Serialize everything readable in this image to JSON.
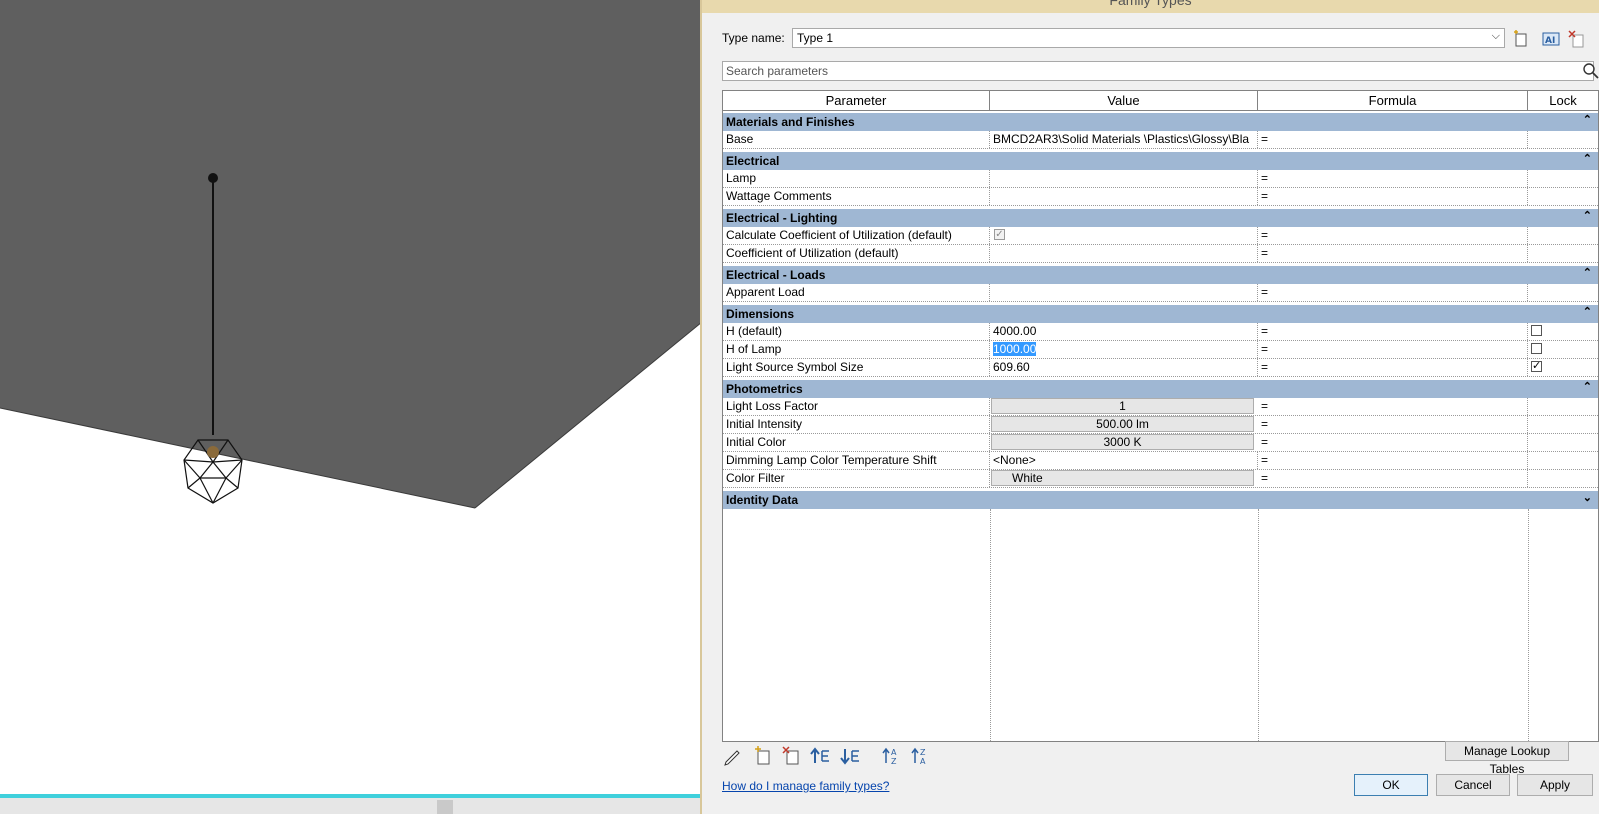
{
  "dialog": {
    "title": "Family Types",
    "type_name_label": "Type name:",
    "type_name_value": "Type 1",
    "search_placeholder": "Search parameters"
  },
  "columns": {
    "parameter": "Parameter",
    "value": "Value",
    "formula": "Formula",
    "lock": "Lock"
  },
  "groups": [
    {
      "label": "Materials and Finishes",
      "state": "expanded"
    },
    {
      "label": "Electrical",
      "state": "expanded"
    },
    {
      "label": "Electrical - Lighting",
      "state": "expanded"
    },
    {
      "label": "Electrical - Loads",
      "state": "expanded"
    },
    {
      "label": "Dimensions",
      "state": "expanded"
    },
    {
      "label": "Photometrics",
      "state": "expanded"
    },
    {
      "label": "Identity Data",
      "state": "collapsed"
    }
  ],
  "rows": {
    "base": {
      "param": "Base",
      "value": "BMCD2AR3\\Solid Materials \\Plastics\\Glossy\\Bla",
      "formula": "="
    },
    "lamp": {
      "param": "Lamp",
      "value": "",
      "formula": "="
    },
    "wattage_comments": {
      "param": "Wattage Comments",
      "value": "",
      "formula": "="
    },
    "calc_cu": {
      "param": "Calculate Coefficient of Utilization (default)",
      "checked": true,
      "formula": "="
    },
    "cu": {
      "param": "Coefficient of Utilization (default)",
      "value": "",
      "formula": "="
    },
    "apparent_load": {
      "param": "Apparent Load",
      "value": "",
      "formula": "="
    },
    "h_default": {
      "param": "H (default)",
      "value": "4000.00",
      "formula": "=",
      "locked": false
    },
    "h_of_lamp": {
      "param": "H of Lamp",
      "value": "1000.00",
      "formula": "=",
      "locked": false
    },
    "light_source_size": {
      "param": "Light Source Symbol Size",
      "value": "609.60",
      "formula": "=",
      "locked": true
    },
    "light_loss": {
      "param": "Light Loss Factor",
      "value": "1",
      "formula": "="
    },
    "initial_intensity": {
      "param": "Initial Intensity",
      "value": "500.00 lm",
      "formula": "="
    },
    "initial_color": {
      "param": "Initial Color",
      "value": "3000 K",
      "formula": "="
    },
    "dimming_shift": {
      "param": "Dimming Lamp Color Temperature Shift",
      "value": "<None>",
      "formula": "="
    },
    "color_filter": {
      "param": "Color Filter",
      "value": "White",
      "formula": "="
    }
  },
  "buttons": {
    "manage_lookup": "Manage Lookup Tables",
    "help_link": "How do I manage family types?",
    "ok": "OK",
    "cancel": "Cancel",
    "apply": "Apply"
  },
  "icons": {
    "toolbar": [
      "new-type-icon",
      "rename-type-icon",
      "delete-type-icon"
    ],
    "bottom": [
      "edit-parameter-icon",
      "new-parameter-icon",
      "delete-parameter-icon",
      "move-up-icon",
      "move-down-icon",
      "sort-ascending-icon",
      "sort-descending-icon"
    ]
  },
  "colors": {
    "group_header": "#9fb7d3",
    "selection": "#3399ff",
    "viewport_plane": "#5f5f5f",
    "accent_line": "#3fd0dc"
  }
}
